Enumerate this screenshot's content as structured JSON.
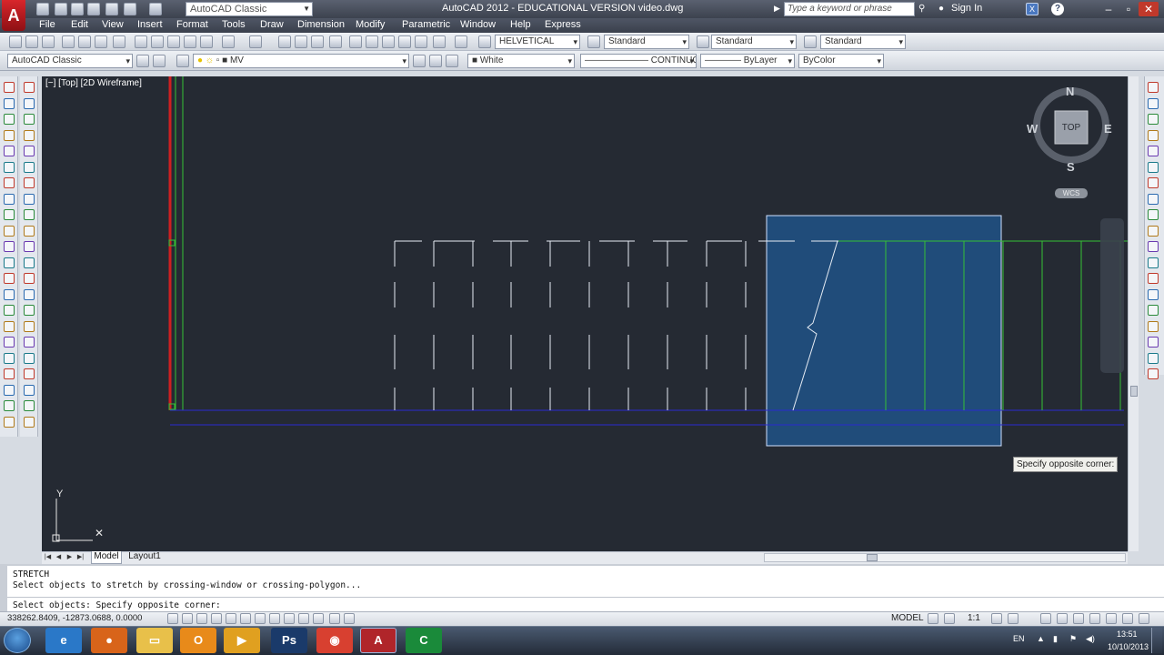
{
  "window": {
    "app_title": "AutoCAD 2012 - EDUCATIONAL VERSION    video.dwg",
    "workspace": "AutoCAD Classic",
    "search_placeholder": "Type a keyword or phrase",
    "sign_in": "Sign In",
    "logo": "A"
  },
  "menu": [
    "File",
    "Edit",
    "View",
    "Insert",
    "Format",
    "Tools",
    "Draw",
    "Dimension",
    "Modify",
    "Parametric",
    "Window",
    "Help",
    "Express"
  ],
  "toolbar1": {
    "text_style": "HELVETICAL",
    "dim_style": "Standard",
    "table_style": "Standard",
    "multileader_style": "Standard"
  },
  "toolbar2": {
    "workspace": "AutoCAD Classic",
    "layer": "MV",
    "color": "White",
    "linetype": "CONTINUOUS",
    "lineweight": "ByLayer",
    "plotstyle": "ByColor"
  },
  "viewport": {
    "label": "[−] [Top] [2D Wireframe]",
    "viewcube": {
      "top_face": "TOP",
      "north": "N",
      "south": "S",
      "east": "E",
      "west": "W"
    },
    "wcs": "WCS",
    "ucs_y_label": "Y",
    "tooltip": "Specify opposite corner:"
  },
  "layout_tabs": [
    "Model",
    "Layout1"
  ],
  "command": {
    "lines": [
      "STRETCH",
      "Select objects to stretch by crossing-window or crossing-polygon...",
      "",
      "Select objects: Specify opposite corner:"
    ]
  },
  "status": {
    "coords": "338262.8409, -12873.0688, 0.0000",
    "model": "MODEL",
    "annotation_scale": "1:1"
  },
  "taskbar": {
    "apps": [
      {
        "name": "ie-icon",
        "color": "#2a78c8",
        "glyph": "e"
      },
      {
        "name": "firefox-icon",
        "color": "#d8641a",
        "glyph": "●"
      },
      {
        "name": "explorer-folder-icon",
        "color": "#e8c04a",
        "glyph": "▭"
      },
      {
        "name": "outlook-icon",
        "color": "#e88a1a",
        "glyph": "O"
      },
      {
        "name": "media-player-icon",
        "color": "#e0a020",
        "glyph": "▶"
      },
      {
        "name": "photoshop-icon",
        "color": "#1a3a6a",
        "glyph": "Ps"
      },
      {
        "name": "chrome-icon",
        "color": "#d84030",
        "glyph": "◉"
      },
      {
        "name": "autocad-taskbar-icon",
        "color": "#b0252a",
        "glyph": "A"
      },
      {
        "name": "camtasia-icon",
        "color": "#1a8a3a",
        "glyph": "C"
      }
    ],
    "language": "EN",
    "time": "13:51",
    "date": "10/10/2013"
  },
  "colors": {
    "canvas": "#252a33",
    "selection_fill": "#1f5a96",
    "green_lines": "#35c135",
    "red_line": "#d02020",
    "blue_line": "#2a2ad0"
  }
}
